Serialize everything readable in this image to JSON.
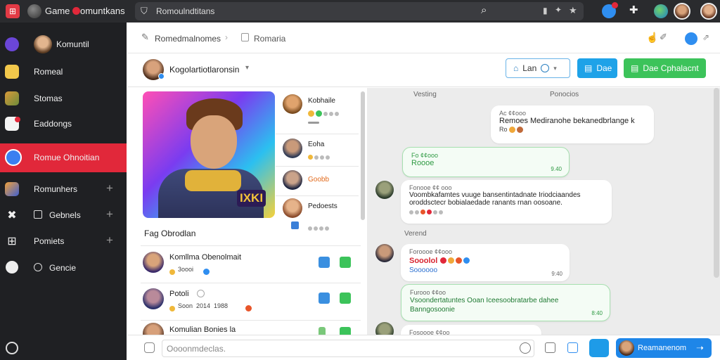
{
  "topbar": {
    "brand_pre": "Game",
    "brand_post": "omuntkans",
    "search_text": "Romoulndtitans"
  },
  "sidebar": {
    "profile": "Komuntil",
    "items": [
      {
        "label": "Romeal"
      },
      {
        "label": "Stomas"
      },
      {
        "label": "Eaddongs"
      },
      {
        "label": "Romue Ohnoitian"
      },
      {
        "label": "Romunhers",
        "plus": "+"
      },
      {
        "label": "Gebnels",
        "plus": "+"
      },
      {
        "label": "Pomiets",
        "plus": "+"
      },
      {
        "label": "Gencie"
      }
    ]
  },
  "header": {
    "crumb1": "Romedmalnomes",
    "crumb2": "Romaria"
  },
  "subheader": {
    "title": "Kogolartiotlaronsin",
    "btn_outline": "Lan",
    "btn_blue": "Dae",
    "btn_green": "Dae Cphalacnt"
  },
  "feature": {
    "badge": "IXKI",
    "caption": "Fag Obrodlan"
  },
  "side_list": [
    {
      "name": "Kobhaile"
    },
    {
      "name": "Eoha"
    },
    {
      "name": "Goobb"
    },
    {
      "name": "Pedoests"
    }
  ],
  "rows": [
    {
      "name": "Komllma Obenolmait",
      "meta": "3oooi"
    },
    {
      "name": "Potoli",
      "meta": "Soon  2014  1988"
    },
    {
      "name": "Komulian Bonies la"
    }
  ],
  "chat": {
    "label_left": "Vesting",
    "label_right": "Ponocios",
    "divider": "Verend",
    "m1": {
      "meta": "Ac ¢¢ooo",
      "text": "Remoes Mediranohe bekanedbrlange k",
      "foot": "Ro"
    },
    "m2": {
      "meta": "Fo ¢¢ooo",
      "text": "Roooe",
      "time": "9.40"
    },
    "m3": {
      "meta": "Fonooe ¢¢ ooo",
      "text": "Voombkafamtes vuuge bansentintadnate Iriodciaandes oroddsctecr bobialaedade ranants rnan oosoane."
    },
    "m4": {
      "meta": "Foroooe ¢¢ooo",
      "text_red": "Sooolol",
      "text": "Soooooo",
      "time": "9:40"
    },
    "m5": {
      "meta": "Furooo ¢¢oo",
      "text": "Vsoondertatuntes Ooan Iceesoobratarbe dahee",
      "text2": "Banngosoonie",
      "time": "8:40"
    },
    "m6": {
      "meta": "Fosoooe ¢¢oo"
    }
  },
  "input": {
    "placeholder": "Oooonmdeclas.",
    "send": "Reamanenom"
  },
  "colors": {
    "accent_red": "#e1283a",
    "blue": "#1e9be8",
    "green": "#3cc35a"
  }
}
